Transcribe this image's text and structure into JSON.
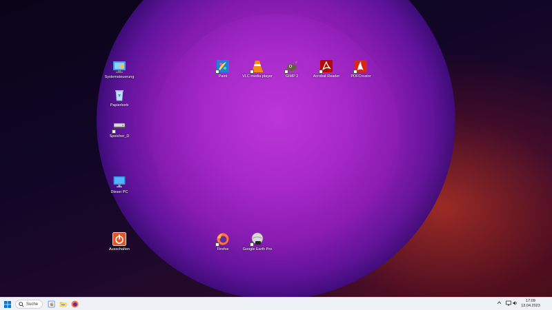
{
  "desktop": {
    "icons": [
      {
        "id": "systemsteuerung",
        "label": "Systemsteuerung"
      },
      {
        "id": "papierkorb",
        "label": "Papierkorb"
      },
      {
        "id": "speicher",
        "label": "Speicher_D"
      },
      {
        "id": "dieser-pc",
        "label": "Dieser PC"
      },
      {
        "id": "ausschalten",
        "label": "Ausschalten"
      },
      {
        "id": "paint",
        "label": "Paint"
      },
      {
        "id": "vlc",
        "label": "VLC media player"
      },
      {
        "id": "gimp",
        "label": "GIMP 2"
      },
      {
        "id": "acrobat",
        "label": "Acrobat Reader"
      },
      {
        "id": "pdfcreator",
        "label": "PDFCreator"
      },
      {
        "id": "firefox",
        "label": "Firefox"
      },
      {
        "id": "google-earth",
        "label": "Google Earth Pro"
      }
    ]
  },
  "taskbar": {
    "search_label": "Suche",
    "clock": {
      "time": "17:09",
      "date": "13.04.2023"
    },
    "apps": [
      "start-icon",
      "search-icon",
      "hand-app-icon",
      "file-explorer-icon",
      "firefox-icon"
    ],
    "tray": [
      "chevron-up-icon",
      "network-icon",
      "speaker-icon"
    ]
  },
  "colors": {
    "accent_windows": "#0078d4",
    "taskbar_bg": "#eef1f6"
  }
}
